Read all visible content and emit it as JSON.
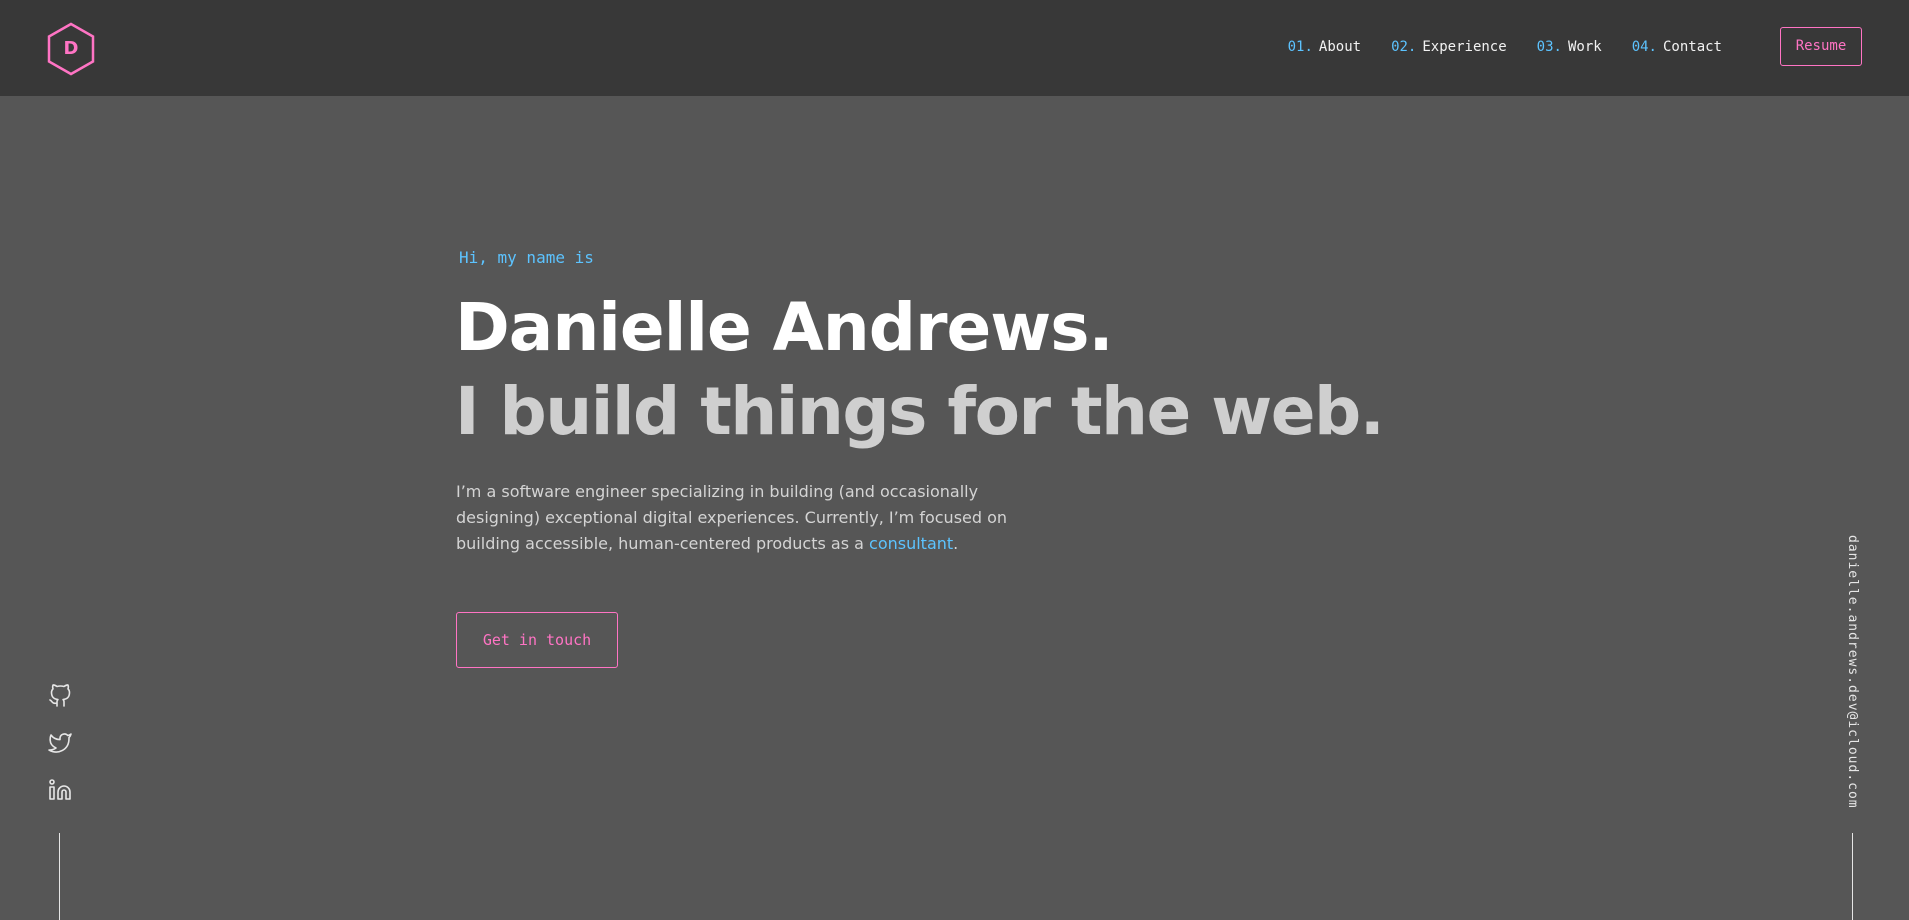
{
  "header": {
    "logo_letter": "D",
    "nav": [
      {
        "num": "01.",
        "label": "About"
      },
      {
        "num": "02.",
        "label": "Experience"
      },
      {
        "num": "03.",
        "label": "Work"
      },
      {
        "num": "04.",
        "label": "Contact"
      }
    ],
    "resume_label": "Resume"
  },
  "hero": {
    "greeting": "Hi, my name is",
    "name": "Danielle Andrews.",
    "tagline": "I build things for the web.",
    "bio_text": "I’m a software engineer specializing in building (and occasionally designing) exceptional digital experiences. Currently, I’m focused on building accessible, human-centered products as a ",
    "bio_link": "consultant",
    "bio_end": ".",
    "cta_label": "Get in touch"
  },
  "social": [
    {
      "icon": "github-icon"
    },
    {
      "icon": "twitter-icon"
    },
    {
      "icon": "linkedin-icon"
    }
  ],
  "email": "danielle.andrews.dev@icloud.com",
  "colors": {
    "background": "#565656",
    "header_bg": "#383838",
    "accent_pink": "#ff74c4",
    "accent_blue": "#5cc3ff",
    "heading": "#ffffff",
    "text": "#d4d4d4"
  }
}
